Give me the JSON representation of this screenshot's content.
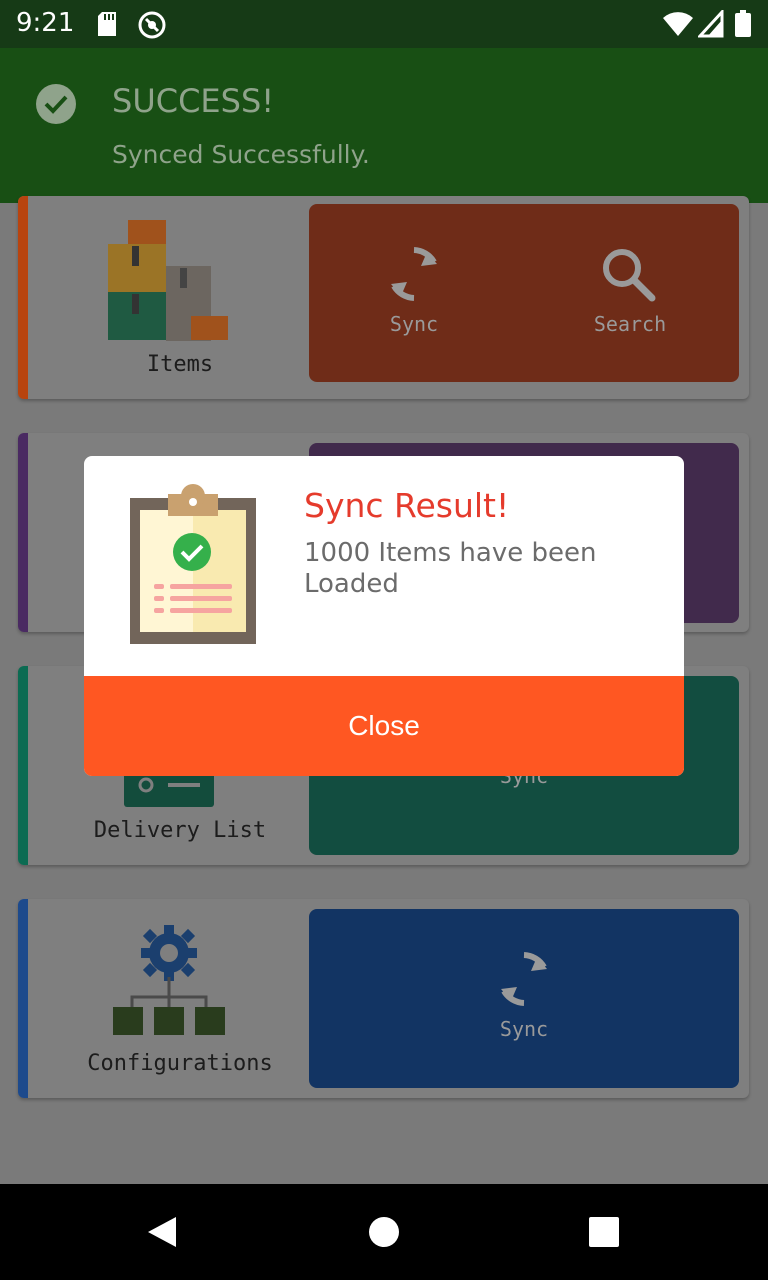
{
  "status_bar": {
    "time": "9:21",
    "icons": [
      "sd-card-icon",
      "no-sync-icon",
      "wifi-icon",
      "signal-icon",
      "battery-icon"
    ]
  },
  "toast": {
    "title": "SUCCESS!",
    "message": "Synced Successfully.",
    "icon": "check-circle-icon"
  },
  "cards": [
    {
      "caption": "Items",
      "accent": "#c2460f",
      "action_color": "#6f2c18",
      "actions": [
        {
          "label": "Sync",
          "icon": "sync-icon"
        },
        {
          "label": "Search",
          "icon": "search-icon"
        }
      ]
    },
    {
      "caption": "",
      "accent": "#5a2a78",
      "action_color": "#412a4c",
      "actions": []
    },
    {
      "caption": "Delivery List",
      "accent": "#0e7a5e",
      "action_color": "#124d40",
      "actions": [
        {
          "label": "Sync",
          "icon": "sync-icon"
        }
      ]
    },
    {
      "caption": "Configurations",
      "accent": "#1d4f9c",
      "action_color": "#123463",
      "actions": [
        {
          "label": "Sync",
          "icon": "sync-icon"
        }
      ]
    }
  ],
  "dialog": {
    "title": "Sync Result!",
    "message": "1000 Items have been Loaded",
    "close_label": "Close",
    "icon": "clipboard-check-icon"
  },
  "nav": {
    "back": "back-icon",
    "home": "home-icon",
    "recents": "recents-icon"
  },
  "colors": {
    "toast_bg": "#184f14",
    "close_button": "#ff5722",
    "dialog_title": "#e53b2c"
  }
}
